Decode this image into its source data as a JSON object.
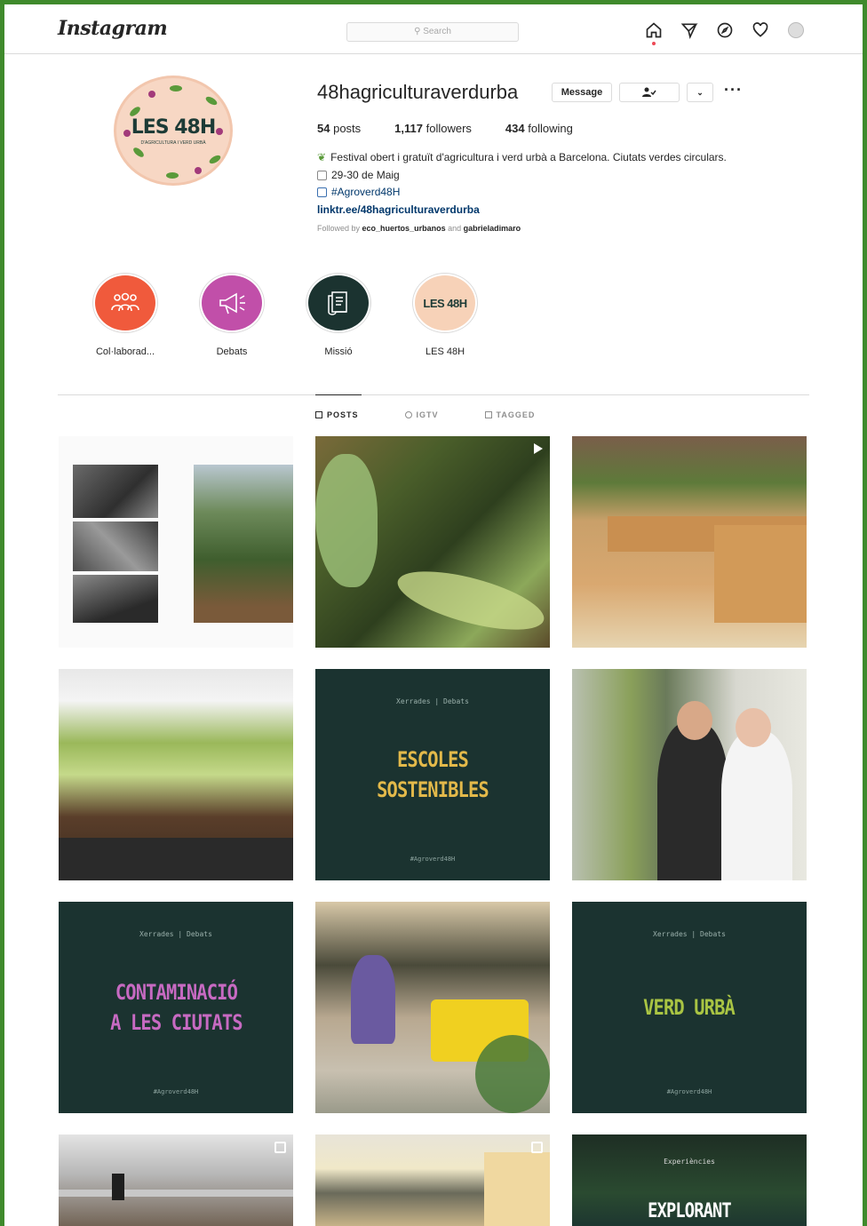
{
  "colors": {
    "frame_border": "#3f8a2c",
    "dark_post": "#1b3330",
    "title_yellow": "#e3b94a",
    "title_pink": "#c76ac2",
    "title_green": "#a9c443"
  },
  "nav": {
    "logo": "Instagram",
    "search_placeholder": "Search",
    "icons": [
      "home-icon",
      "direct-icon",
      "explore-icon",
      "heart-icon",
      "avatar"
    ]
  },
  "profile": {
    "picture_title": "LES 48H",
    "picture_subtitle": "D'AGRICULTURA I VERD URBÀ",
    "username": "48hagriculturaverdurba",
    "message_label": "Message",
    "stats": {
      "posts_count": "54",
      "posts_label": "posts",
      "followers_count": "1,117",
      "followers_label": "followers",
      "following_count": "434",
      "following_label": "following"
    },
    "bio": {
      "line1": "Festival obert i gratuït d'agricultura i verd urbà a Barcelona. Ciutats verdes circulars.",
      "line2": "29-30 de Maig",
      "line3": "#Agroverd48H",
      "link": "linktr.ee/48hagriculturaverdurba",
      "followed_prefix": "Followed by",
      "followed_user1": "eco_huertos_urbanos",
      "followed_and": "and",
      "followed_user2": "gabrieladimaro"
    }
  },
  "highlights": [
    {
      "label": "Col·laborad...",
      "color": "#f05a3c",
      "icon": "people-icon"
    },
    {
      "label": "Debats",
      "color": "#c14fa9",
      "icon": "megaphone-icon"
    },
    {
      "label": "Missió",
      "color": "#1b3330",
      "icon": "scroll-icon"
    },
    {
      "label": "LES 48H",
      "color": "#f7d2b8",
      "icon": "text",
      "text": "LES 48H"
    }
  ],
  "tabs": [
    {
      "label": "POSTS",
      "active": true
    },
    {
      "label": "IGTV",
      "active": false
    },
    {
      "label": "TAGGED",
      "active": false
    }
  ],
  "posts": {
    "p5": {
      "kicker": "Xerrades | Debats",
      "title1": "ESCOLES",
      "title2": "SOSTENIBLES",
      "foot": "#Agroverd48H"
    },
    "p7": {
      "kicker": "Xerrades | Debats",
      "title1": "CONTAMINACIÓ",
      "title2": "A LES CIUTATS",
      "foot": "#Agroverd48H"
    },
    "p9": {
      "kicker": "Xerrades | Debats",
      "title1": "VERD URBÀ",
      "foot": "#Agroverd48H"
    },
    "p12": {
      "kicker": "Experiències",
      "title1": "EXPLORANT"
    }
  }
}
